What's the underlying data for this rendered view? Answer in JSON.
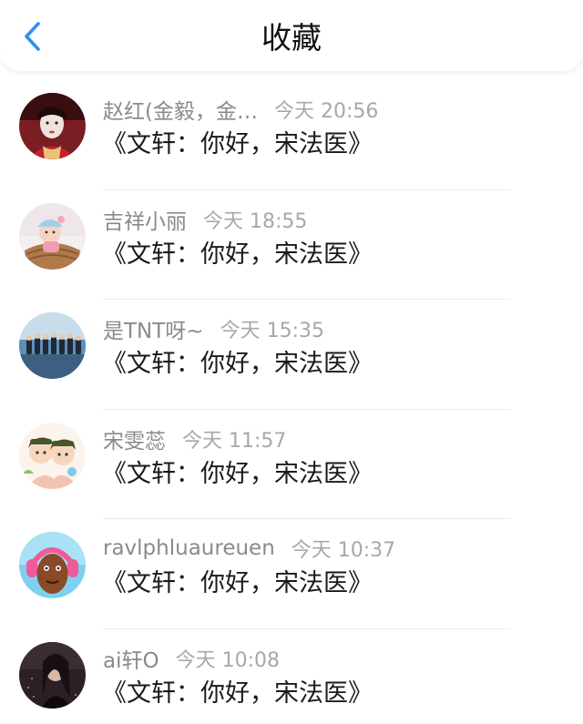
{
  "header": {
    "title": "收藏",
    "back_icon": "chevron-left-icon",
    "accent_color": "#2f8ff0"
  },
  "items": [
    {
      "name": "赵红(金毅，金…",
      "time": "今天 20:56",
      "message": "《文轩：你好，宋法医》",
      "avatar": "portrait-avatar"
    },
    {
      "name": "吉祥小丽",
      "time": "今天 18:55",
      "message": "《文轩：你好，宋法医》",
      "avatar": "baby-avatar"
    },
    {
      "name": "是TNT呀~",
      "time": "今天 15:35",
      "message": "《文轩：你好，宋法医》",
      "avatar": "group-photo-avatar"
    },
    {
      "name": "宋雯蕊",
      "time": "今天 11:57",
      "message": "《文轩：你好，宋法医》",
      "avatar": "cartoon-kids-avatar"
    },
    {
      "name": "ravlphluaureuen",
      "time": "今天 10:37",
      "message": "《文轩：你好，宋法医》",
      "avatar": "headphones-character-avatar"
    },
    {
      "name": "ai轩O",
      "time": "今天 10:08",
      "message": "《文轩：你好，宋法医》",
      "avatar": "night-photo-avatar"
    }
  ]
}
